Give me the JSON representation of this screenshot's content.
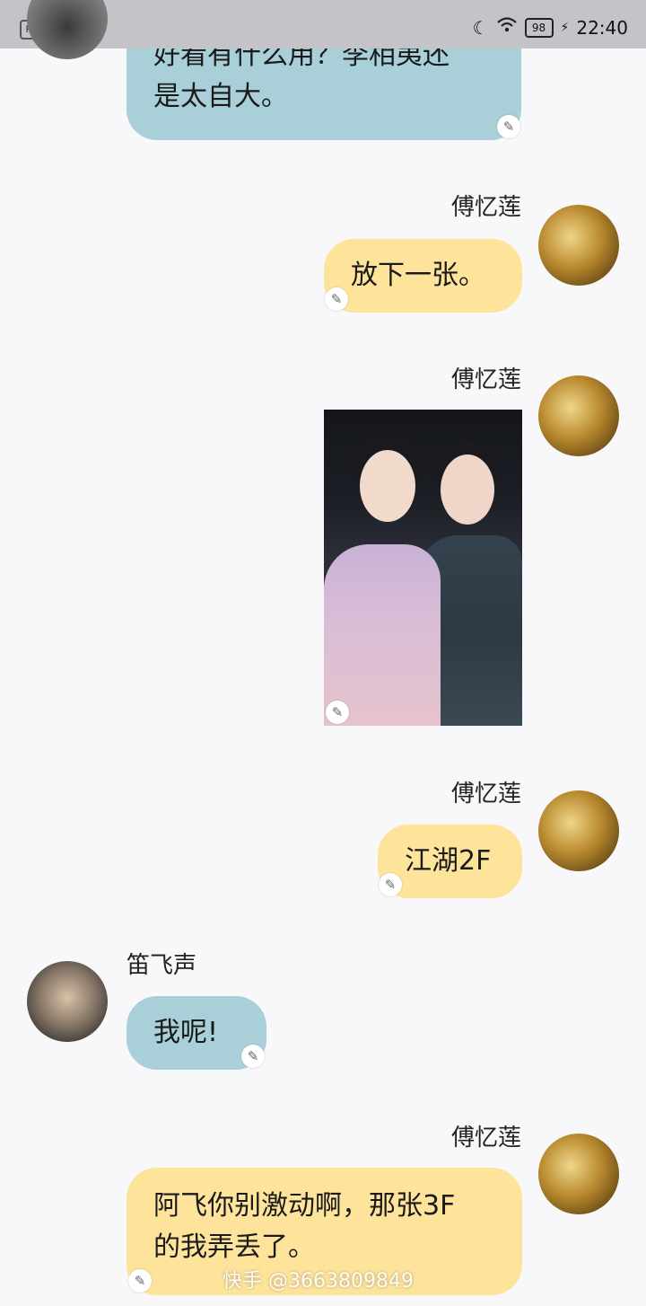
{
  "status_bar": {
    "badge": "PD",
    "battery": "98",
    "time": "22:40"
  },
  "messages": [
    {
      "sender": "",
      "side": "left",
      "type": "text",
      "text_lines": [
        "好看有什么用？李相夷还",
        "是太自大。"
      ]
    },
    {
      "sender": "傅忆莲",
      "side": "right",
      "type": "text",
      "text_lines": [
        "放下一张。"
      ]
    },
    {
      "sender": "傅忆莲",
      "side": "right",
      "type": "image",
      "alt": "photo"
    },
    {
      "sender": "傅忆莲",
      "side": "right",
      "type": "text",
      "text_lines": [
        "江湖2F"
      ]
    },
    {
      "sender": "笛飞声",
      "side": "left",
      "type": "text",
      "text_lines": [
        "我呢!"
      ]
    },
    {
      "sender": "傅忆莲",
      "side": "right",
      "type": "text",
      "text_lines": [
        "阿飞你别激动啊，那张3F",
        "的我弄丢了。"
      ]
    }
  ],
  "watermark": "快手 @3663809849",
  "colors": {
    "bubble_blue": "#a9d0d8",
    "bubble_yellow": "#fee49a",
    "background": "#f8f8fb"
  },
  "icons": {
    "edit": "pencil-icon",
    "status": [
      "moon-icon",
      "wifi-icon",
      "battery-icon",
      "charging-icon"
    ]
  }
}
